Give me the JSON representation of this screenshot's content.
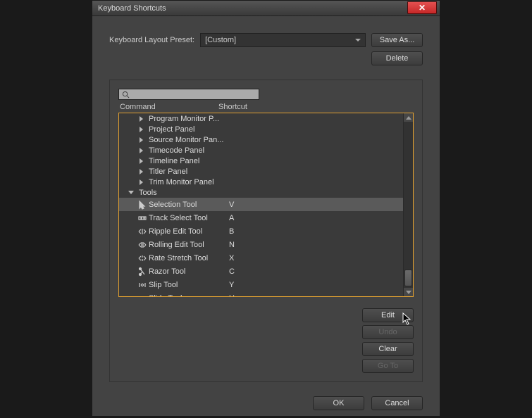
{
  "title": "Keyboard Shortcuts",
  "preset": {
    "label": "Keyboard Layout Preset:",
    "value": "[Custom]"
  },
  "buttons": {
    "save_as": "Save As...",
    "delete": "Delete",
    "edit": "Edit",
    "undo": "Undo",
    "clear": "Clear",
    "goto": "Go To",
    "ok": "OK",
    "cancel": "Cancel"
  },
  "columns": {
    "command": "Command",
    "shortcut": "Shortcut"
  },
  "panels": [
    "Program Monitor P...",
    "Project Panel",
    "Source Monitor Pan...",
    "Timecode Panel",
    "Timeline Panel",
    "Titler Panel",
    "Trim Monitor Panel"
  ],
  "tools_label": "Tools",
  "tools": [
    {
      "name": "Selection Tool",
      "shortcut": "V",
      "icon": "arrow",
      "selected": true
    },
    {
      "name": "Track Select Tool",
      "shortcut": "A",
      "icon": "track",
      "selected": false
    },
    {
      "name": "Ripple Edit Tool",
      "shortcut": "B",
      "icon": "ripple",
      "selected": false
    },
    {
      "name": "Rolling Edit Tool",
      "shortcut": "N",
      "icon": "rolling",
      "selected": false
    },
    {
      "name": "Rate Stretch Tool",
      "shortcut": "X",
      "icon": "ratestretch",
      "selected": false
    },
    {
      "name": "Razor Tool",
      "shortcut": "C",
      "icon": "razor",
      "selected": false
    },
    {
      "name": "Slip Tool",
      "shortcut": "Y",
      "icon": "slip",
      "selected": false
    },
    {
      "name": "Slide Tool",
      "shortcut": "U",
      "icon": "slide",
      "selected": false
    }
  ]
}
